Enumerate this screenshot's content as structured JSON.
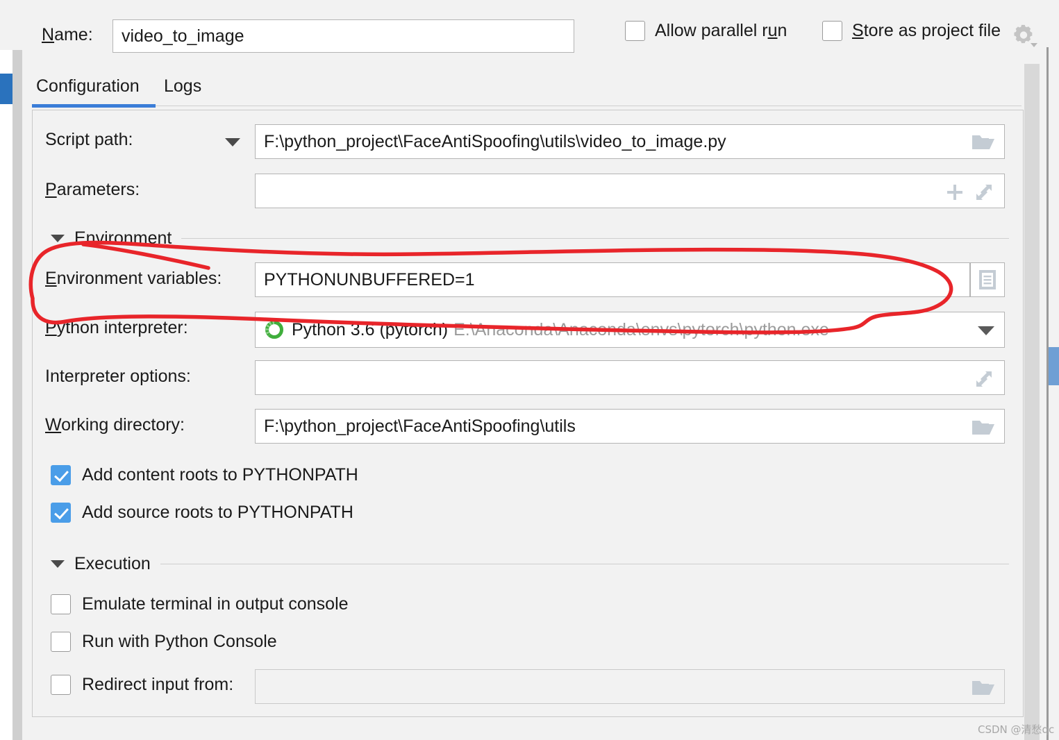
{
  "window": {
    "name_label": "Name:",
    "name_label_accel": "N",
    "name_value": "video_to_image",
    "gear_icon": "gear-icon"
  },
  "header_options": [
    {
      "label": "Allow parallel run",
      "accel": "u",
      "checked": false,
      "name": "allow-parallel-run"
    },
    {
      "label": "Store as project file",
      "accel": "S",
      "checked": false,
      "name": "store-as-project-file"
    }
  ],
  "tabs": [
    {
      "label": "Configuration",
      "selected": true
    },
    {
      "label": "Logs",
      "selected": false
    }
  ],
  "fields": {
    "script_path": {
      "label": "Script path:",
      "value": "F:\\python_project\\FaceAntiSpoofing\\utils\\video_to_image.py",
      "browse_icon": "folder-icon",
      "dropdown_icon": "chevron-down-icon"
    },
    "parameters": {
      "label": "Parameters:",
      "label_accel": "P",
      "value": "",
      "insert_icon": "plus-icon",
      "expand_icon": "expand-icon"
    },
    "environment_variables": {
      "label": "Environment variables:",
      "label_accel": "E",
      "value": "PYTHONUNBUFFERED=1",
      "edit_icon": "document-list-icon"
    },
    "python_interpreter": {
      "label": "Python interpreter:",
      "label_accel": "P",
      "value": "Python 3.6 (pytorch)",
      "value_path": "E:\\Anaconda\\Anaconda\\envs\\pytorch\\python.exe",
      "interpreter_icon": "conda-ring-icon",
      "dropdown_icon": "chevron-down-icon"
    },
    "interpreter_options": {
      "label": "Interpreter options:",
      "value": "",
      "expand_icon": "expand-icon"
    },
    "working_directory": {
      "label": "Working directory:",
      "label_accel": "W",
      "value": "F:\\python_project\\FaceAntiSpoofing\\utils",
      "browse_icon": "folder-icon"
    },
    "redirect_input": {
      "label": "Redirect input from:",
      "checked": false,
      "value": "",
      "browse_icon": "folder-icon",
      "disabled": true
    }
  },
  "sections": {
    "environment": {
      "title": "Environment",
      "expanded": true
    },
    "execution": {
      "title": "Execution",
      "expanded": true
    }
  },
  "path_options": [
    {
      "label": "Add content roots to PYTHONPATH",
      "checked": true,
      "name": "add-content-roots"
    },
    {
      "label": "Add source roots to PYTHONPATH",
      "checked": true,
      "name": "add-source-roots"
    }
  ],
  "execution_options": [
    {
      "label": "Emulate terminal in output console",
      "checked": false,
      "name": "emulate-terminal"
    },
    {
      "label": "Run with Python Console",
      "checked": false,
      "name": "run-with-python-console"
    }
  ],
  "annotation": {
    "type": "hand-drawn-ellipse",
    "color": "#e8252a",
    "targets": "Environment variables row"
  },
  "watermark": "CSDN @清愁qc",
  "colors": {
    "accent_blue": "#3b7dd8",
    "checkbox_checked": "#4a9de8",
    "annotation_red": "#e8252a",
    "conda_green": "#3fae3c",
    "panel_bg": "#f2f2f2",
    "field_bg": "#ffffff"
  }
}
